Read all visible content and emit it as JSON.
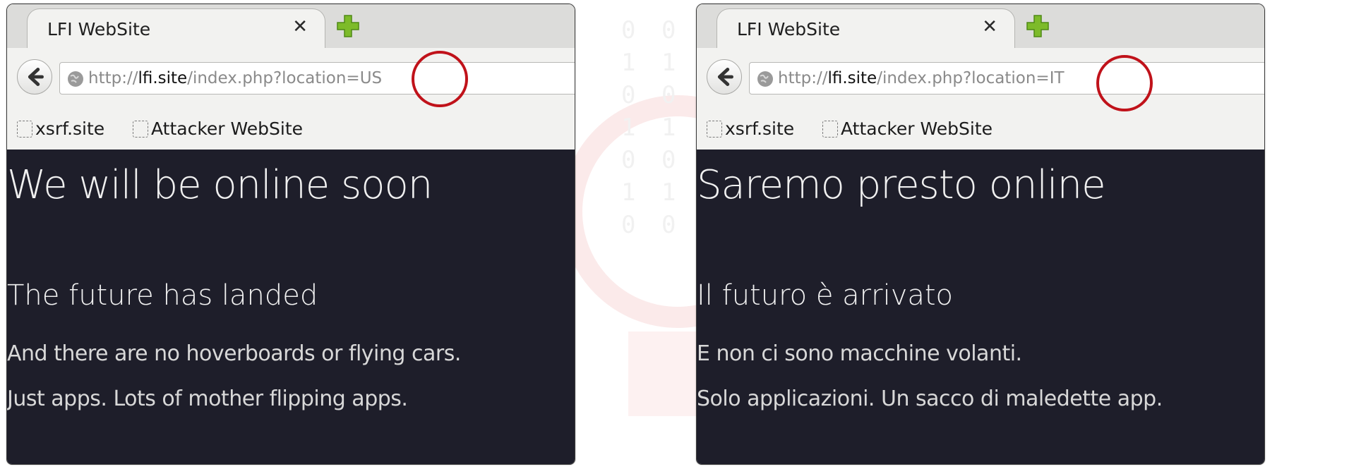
{
  "colors": {
    "page_bg": "#1e1e2a",
    "highlight_circle": "#c0121a",
    "newtab_plus": "#7dbb2a"
  },
  "browsers": [
    {
      "tab_title": "LFI WebSite",
      "tab_close": "✕",
      "url_scheme": "http://",
      "url_host": "lfi.site",
      "url_path": "/index.php?location=US",
      "bookmarks": [
        "xsrf.site",
        "Attacker WebSite"
      ],
      "heading": "We will be online soon",
      "subheading": "The future has landed",
      "line1": "And there are no hoverboards or flying cars.",
      "line2": "Just apps. Lots of mother flipping apps."
    },
    {
      "tab_title": "LFI WebSite",
      "tab_close": "✕",
      "url_scheme": "http://",
      "url_host": "lfi.site",
      "url_path": "/index.php?location=IT",
      "bookmarks": [
        "xsrf.site",
        "Attacker WebSite"
      ],
      "heading": "Saremo presto online",
      "subheading": "Il futuro è arrivato",
      "line1": "E non ci sono macchine volanti.",
      "line2": "Solo applicazioni. Un sacco di maledette app."
    }
  ]
}
